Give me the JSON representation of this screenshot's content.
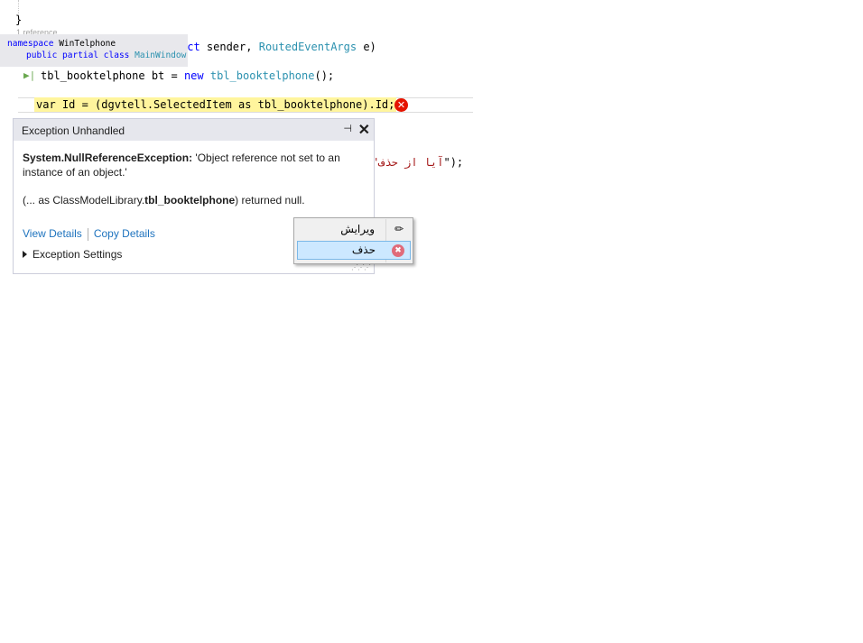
{
  "code": {
    "brace": "}",
    "reference_hint": "1 reference",
    "method_tail": {
      "kw": "ect",
      "text1": " sender, ",
      "type": "RoutedEventArgs",
      "text2": " e)"
    },
    "line_new": {
      "t1": "tbl_booktelphone",
      "t2": " bt = ",
      "kw": "new",
      "t3": " ",
      "type": "tbl_booktelphone",
      "t4": "();"
    },
    "line_error": {
      "kw": "var",
      "rest": " Id = (dgvtell.SelectedItem as tbl_booktelphone).Id;"
    },
    "line_string": {
      "str": "\"آیا از حذف",
      "tail": "\");"
    }
  },
  "namespace_tooltip": {
    "kw1": "namespace",
    "name": " WinTelphone",
    "kw2": "public partial class",
    "class_name": "MainWindow"
  },
  "exception": {
    "title": "Exception Unhandled",
    "pin_icon": "pin-icon",
    "close_icon": "close-icon",
    "type": "System.NullReferenceException:",
    "message": " 'Object reference not set to an instance of an object.'",
    "null_prefix": "(... as ClassModelLibrary.",
    "null_bold": "tbl_booktelphone",
    "null_suffix": ") returned null.",
    "view_details": "View Details",
    "copy_details": "Copy Details",
    "settings": "Exception Settings"
  },
  "context_menu": {
    "items": [
      {
        "label": "ویرایش",
        "icon": "pencil-icon"
      },
      {
        "label": "حذف",
        "icon": "delete-icon",
        "selected": true
      }
    ]
  },
  "colors": {
    "error": "#e51400",
    "highlight": "#fff59d",
    "link": "#1e73be",
    "selection": "#cce8ff"
  }
}
